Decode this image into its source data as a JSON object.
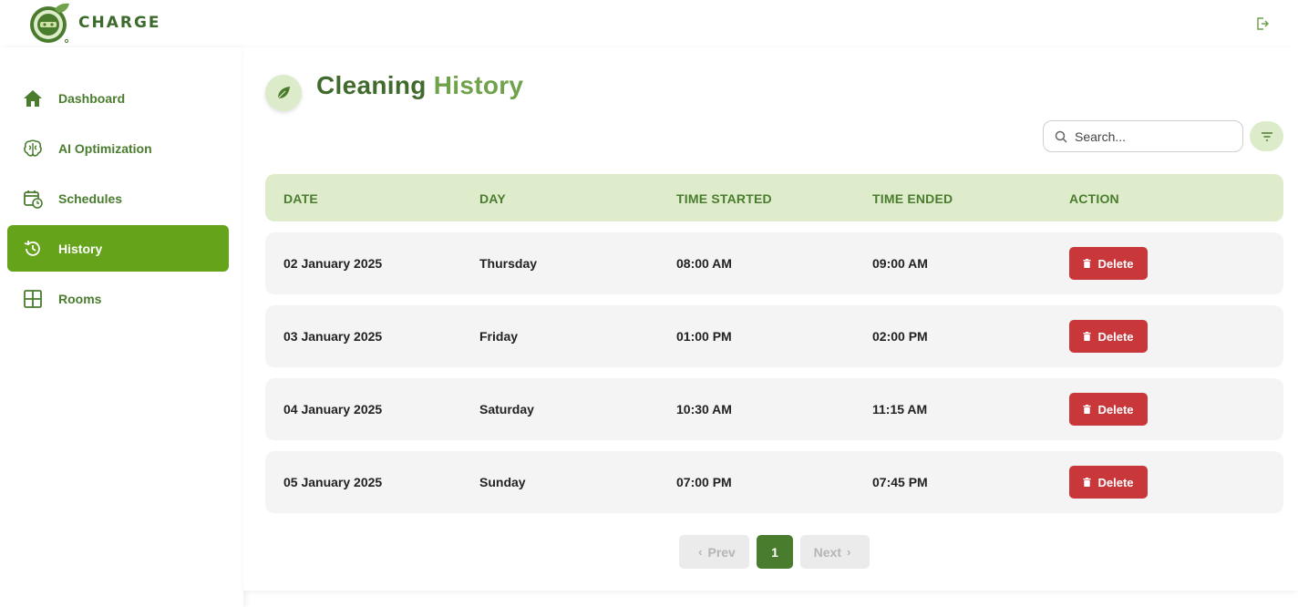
{
  "brand": {
    "name": "CHARGE"
  },
  "sidebar": {
    "items": [
      {
        "label": "Dashboard",
        "icon": "home-icon"
      },
      {
        "label": "AI Optimization",
        "icon": "brain-icon"
      },
      {
        "label": "Schedules",
        "icon": "calendar-clock-icon"
      },
      {
        "label": "History",
        "icon": "history-icon",
        "active": true
      },
      {
        "label": "Rooms",
        "icon": "grid-icon"
      }
    ]
  },
  "page": {
    "title_part1": "Cleaning",
    "title_part2": "History",
    "title_icon": "leaf-icon"
  },
  "search": {
    "placeholder": "Search..."
  },
  "table": {
    "columns": [
      "DATE",
      "DAY",
      "TIME STARTED",
      "TIME ENDED",
      "ACTION"
    ],
    "rows": [
      {
        "date": "02 January 2025",
        "day": "Thursday",
        "start": "08:00 AM",
        "end": "09:00 AM",
        "action": "Delete"
      },
      {
        "date": "03 January 2025",
        "day": "Friday",
        "start": "01:00 PM",
        "end": "02:00 PM",
        "action": "Delete"
      },
      {
        "date": "04 January 2025",
        "day": "Saturday",
        "start": "10:30 AM",
        "end": "11:15 AM",
        "action": "Delete"
      },
      {
        "date": "05 January 2025",
        "day": "Sunday",
        "start": "07:00 PM",
        "end": "07:45 PM",
        "action": "Delete"
      }
    ]
  },
  "pagination": {
    "prev_label": "Prev",
    "current_page": "1",
    "next_label": "Next"
  },
  "colors": {
    "brand_green": "#4a7c2e",
    "active_nav": "#65a31a",
    "header_bg": "#dfeccc",
    "delete_red": "#c8373a"
  }
}
